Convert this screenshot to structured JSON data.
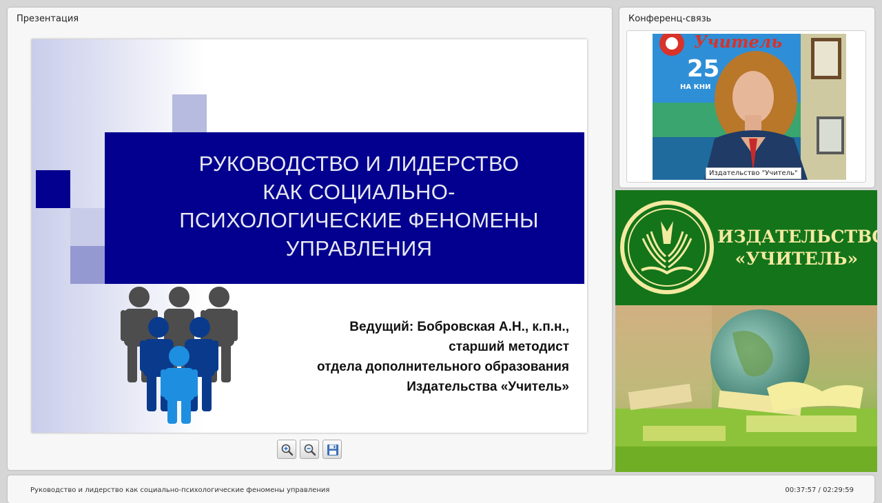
{
  "presentation_panel": {
    "title": "Презентация",
    "slide": {
      "title_lines": [
        "РУКОВОДСТВО И ЛИДЕРСТВО",
        "КАК СОЦИАЛЬНО-",
        "ПСИХОЛОГИЧЕСКИЕ ФЕНОМЕНЫ",
        "УПРАВЛЕНИЯ"
      ],
      "presenter_lines": [
        "Ведущий: Бобровская А.Н., к.п.н.,",
        "старший методист",
        "отдела дополнительного образования",
        "Издательства «Учитель»"
      ]
    },
    "toolbar": [
      {
        "name": "zoom-in-button",
        "icon": "zoom-in-icon"
      },
      {
        "name": "zoom-out-button",
        "icon": "zoom-out-icon"
      },
      {
        "name": "save-button",
        "icon": "floppy-disk-icon"
      }
    ]
  },
  "conference_panel": {
    "title": "Конференц-связь",
    "camera_label": "Издательство \"Учитель\"",
    "background_sign": {
      "brand": "Учитель",
      "number": "25",
      "subtext": "НА КНИ"
    }
  },
  "publisher_banner": {
    "line1": "ИЗДАТЕЛЬСТВО",
    "line2": "«УЧИТЕЛЬ»",
    "bg_color": "#14741a",
    "text_color": "#f3eaa0"
  },
  "bottom_bar": {
    "presentation_title": "Руководство и лидерство как социально-психологические феномены управления",
    "time_current": "00:37:57",
    "time_separator": "/",
    "time_total": "02:29:59"
  }
}
